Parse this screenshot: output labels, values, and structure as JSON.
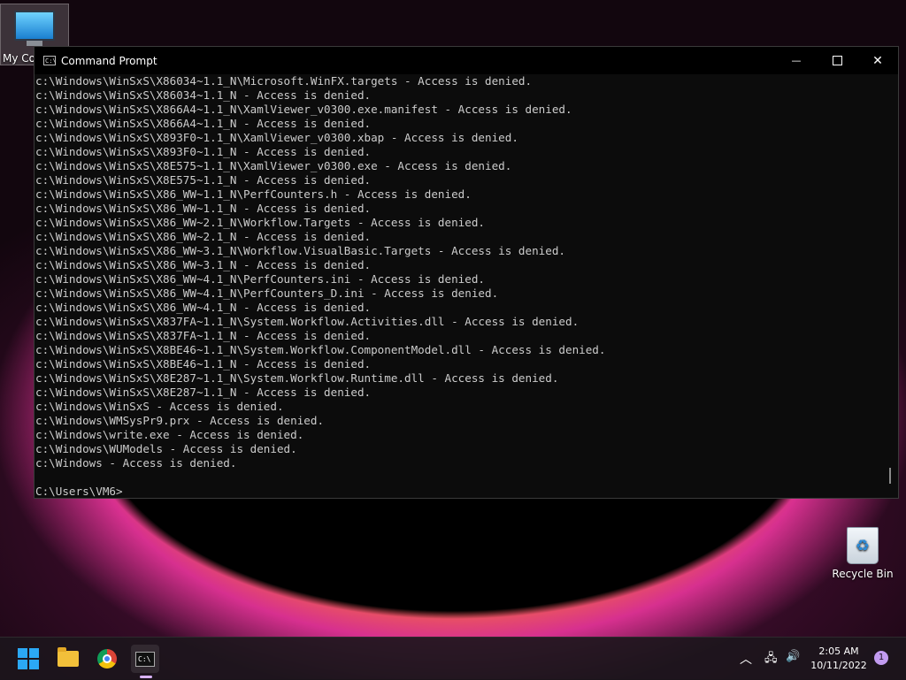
{
  "desktop": {
    "my_computer_label": "My Com",
    "recycle_bin_label": "Recycle Bin"
  },
  "window": {
    "title": "Command Prompt",
    "minimize_glyph": "—",
    "close_glyph": "✕"
  },
  "console_lines": [
    "c:\\Windows\\WinSxS\\X86034~1.1_N\\Microsoft.WinFX.targets - Access is denied.",
    "c:\\Windows\\WinSxS\\X86034~1.1_N - Access is denied.",
    "c:\\Windows\\WinSxS\\X866A4~1.1_N\\XamlViewer_v0300.exe.manifest - Access is denied.",
    "c:\\Windows\\WinSxS\\X866A4~1.1_N - Access is denied.",
    "c:\\Windows\\WinSxS\\X893F0~1.1_N\\XamlViewer_v0300.xbap - Access is denied.",
    "c:\\Windows\\WinSxS\\X893F0~1.1_N - Access is denied.",
    "c:\\Windows\\WinSxS\\X8E575~1.1_N\\XamlViewer_v0300.exe - Access is denied.",
    "c:\\Windows\\WinSxS\\X8E575~1.1_N - Access is denied.",
    "c:\\Windows\\WinSxS\\X86_WW~1.1_N\\PerfCounters.h - Access is denied.",
    "c:\\Windows\\WinSxS\\X86_WW~1.1_N - Access is denied.",
    "c:\\Windows\\WinSxS\\X86_WW~2.1_N\\Workflow.Targets - Access is denied.",
    "c:\\Windows\\WinSxS\\X86_WW~2.1_N - Access is denied.",
    "c:\\Windows\\WinSxS\\X86_WW~3.1_N\\Workflow.VisualBasic.Targets - Access is denied.",
    "c:\\Windows\\WinSxS\\X86_WW~3.1_N - Access is denied.",
    "c:\\Windows\\WinSxS\\X86_WW~4.1_N\\PerfCounters.ini - Access is denied.",
    "c:\\Windows\\WinSxS\\X86_WW~4.1_N\\PerfCounters_D.ini - Access is denied.",
    "c:\\Windows\\WinSxS\\X86_WW~4.1_N - Access is denied.",
    "c:\\Windows\\WinSxS\\X837FA~1.1_N\\System.Workflow.Activities.dll - Access is denied.",
    "c:\\Windows\\WinSxS\\X837FA~1.1_N - Access is denied.",
    "c:\\Windows\\WinSxS\\X8BE46~1.1_N\\System.Workflow.ComponentModel.dll - Access is denied.",
    "c:\\Windows\\WinSxS\\X8BE46~1.1_N - Access is denied.",
    "c:\\Windows\\WinSxS\\X8E287~1.1_N\\System.Workflow.Runtime.dll - Access is denied.",
    "c:\\Windows\\WinSxS\\X8E287~1.1_N - Access is denied.",
    "c:\\Windows\\WinSxS - Access is denied.",
    "c:\\Windows\\WMSysPr9.prx - Access is denied.",
    "c:\\Windows\\write.exe - Access is denied.",
    "c:\\Windows\\WUModels - Access is denied.",
    "c:\\Windows - Access is denied.",
    "",
    "C:\\Users\\VM6>"
  ],
  "taskbar": {
    "clock_time": "2:05 AM",
    "clock_date": "10/11/2022",
    "notification_count": "1",
    "tray_chevron": "︿",
    "volume_glyph": "🔊",
    "network_glyph": "🖧"
  }
}
